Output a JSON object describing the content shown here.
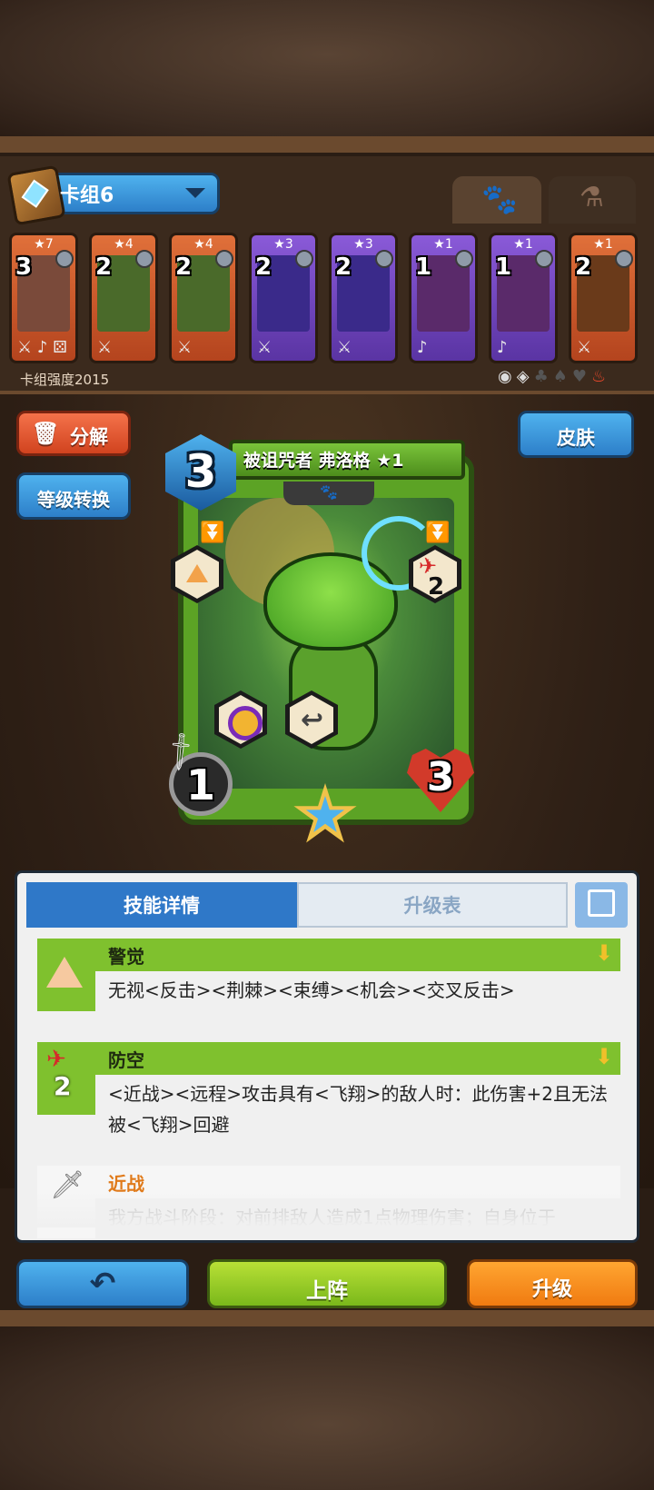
{
  "deck": {
    "name": "卡组6",
    "strength_label": "卡组强度2015",
    "tabs": [
      "paw-icon",
      "potion-icon"
    ]
  },
  "cards": [
    {
      "stars": "★7",
      "cost": "3",
      "faction": "orange",
      "art": "#7a4a3a",
      "weapons": "⚔ ♪ ⚄"
    },
    {
      "stars": "★4",
      "cost": "2",
      "faction": "orange",
      "art": "#4a6a2a",
      "weapons": "⚔"
    },
    {
      "stars": "★4",
      "cost": "2",
      "faction": "orange",
      "art": "#4a6a2a",
      "weapons": "⚔"
    },
    {
      "stars": "★3",
      "cost": "2",
      "faction": "purple",
      "art": "#3a2a8a",
      "weapons": "⚔"
    },
    {
      "stars": "★3",
      "cost": "2",
      "faction": "purple",
      "art": "#3a2a8a",
      "weapons": "⚔"
    },
    {
      "stars": "★1",
      "cost": "1",
      "faction": "purple",
      "art": "#5a2a6a",
      "weapons": "♪"
    },
    {
      "stars": "★1",
      "cost": "1",
      "faction": "purple",
      "art": "#5a2a6a",
      "weapons": "♪"
    },
    {
      "stars": "★1",
      "cost": "2",
      "faction": "orange",
      "art": "#6a3a1a",
      "weapons": "⚔"
    }
  ],
  "buttons": {
    "disenchant": "分解",
    "level_convert": "等级转换",
    "skin": "皮肤",
    "deploy": "上阵",
    "upgrade": "升级",
    "back": "↶"
  },
  "hero": {
    "name": "被诅咒者 弗洛格 ★1",
    "cost": "3",
    "attack": "1",
    "health": "3",
    "anti_air_value": "2"
  },
  "details": {
    "tab_skill": "技能详情",
    "tab_upgrade": "升级表",
    "abilities": [
      {
        "name": "警觉",
        "desc": "无视<反击><荆棘><束缚><机会><交叉反击>"
      },
      {
        "name": "防空",
        "value": "2",
        "desc": "<近战><远程>攻击具有<飞翔>的敌人时：此伤害+2且无法被<飞翔>回避"
      },
      {
        "name": "近战",
        "desc": "我方战斗阶段：对前排敌人造成1点物理伤害；自身位于"
      }
    ]
  },
  "colors": {
    "blue": "#2f78c8",
    "green": "#7fc12e",
    "orange": "#f07b11",
    "red": "#d1431f"
  }
}
